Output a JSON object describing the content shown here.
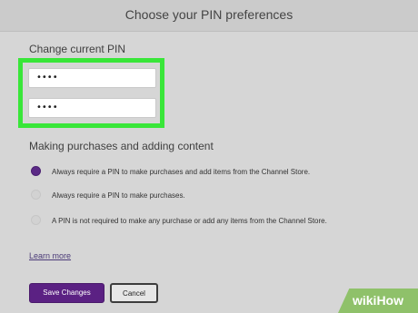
{
  "header": {
    "title": "Choose your PIN preferences"
  },
  "pin": {
    "label": "Change current PIN",
    "field1": "••••",
    "field2": "••••"
  },
  "purchases": {
    "label": "Making purchases and adding content",
    "options": [
      {
        "label": "Always require a PIN to make purchases and add items from the Channel Store.",
        "selected": true
      },
      {
        "label": "Always require a PIN to make purchases.",
        "selected": false
      },
      {
        "label": "A PIN is not required to make any purchase or add any items from the Channel Store.",
        "selected": false
      }
    ]
  },
  "learn_more": "Learn more",
  "buttons": {
    "save": "Save Changes",
    "cancel": "Cancel"
  },
  "watermark": "wikiHow",
  "colors": {
    "accent": "#5b2183",
    "highlight": "#39e639"
  }
}
